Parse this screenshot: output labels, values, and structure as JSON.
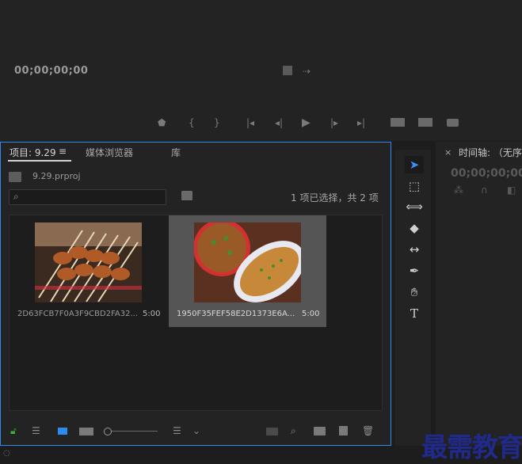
{
  "source_monitor": {
    "timecode": "00;00;00;00",
    "controls": [
      "marker-icon",
      "mark-in-icon",
      "mark-out-icon",
      "go-to-in-icon",
      "step-back-icon",
      "play-icon",
      "step-forward-icon",
      "go-to-out-icon",
      "insert-icon",
      "overwrite-icon",
      "export-frame-icon"
    ]
  },
  "project_panel": {
    "tabs": [
      {
        "label": "项目: 9.29"
      },
      {
        "label": "媒体浏览器"
      },
      {
        "label": "库"
      }
    ],
    "menu_glyph": "≡",
    "project_file": "9.29.prproj",
    "search_placeholder": "",
    "selection_status": "1 项已选择，共 2 项",
    "clips": [
      {
        "name": "2D63FCB7F0A3F9CBD2FA32...",
        "duration": "5:00",
        "selected": false
      },
      {
        "name": "1950F35FEF58E2D1373E6A...",
        "duration": "5:00",
        "selected": true
      }
    ]
  },
  "timeline_panel": {
    "close_glyph": "×",
    "title": "时间轴: （无序",
    "timecode": "00;00;00;00"
  },
  "watermark": "最需教育",
  "colors": {
    "accent": "#2d8ceb",
    "panel_bg": "#232323",
    "selected_clip_bg": "#555555",
    "lock_green": "#3fae3f"
  }
}
